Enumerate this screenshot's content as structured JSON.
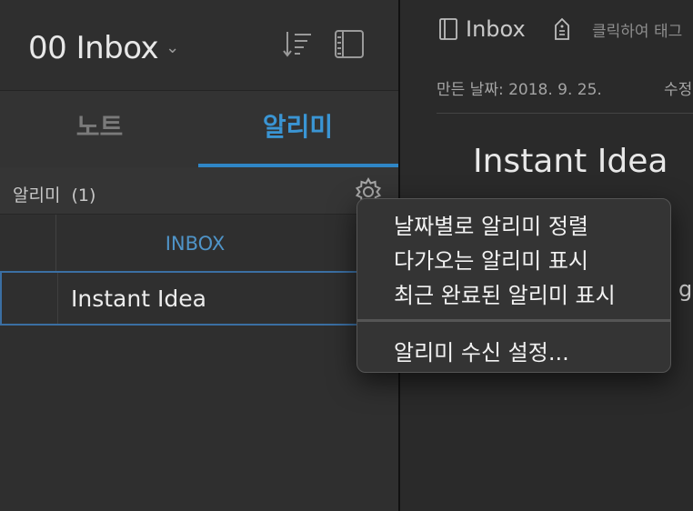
{
  "notebook": {
    "title": "00 Inbox"
  },
  "tabs": [
    {
      "label": "노트",
      "active": false
    },
    {
      "label": "알리미",
      "active": true
    }
  ],
  "section": {
    "label": "알리미",
    "count": "(1)"
  },
  "list": {
    "group_label": "INBOX",
    "items": [
      {
        "title": "Instant Idea"
      }
    ]
  },
  "note": {
    "notebook_name": "Inbox",
    "tag_placeholder": "클릭하여 태그",
    "created": "만든 날짜: 2018. 9. 25.",
    "modified_prefix": "수정",
    "title": "Instant Idea",
    "body_peek": "gli"
  },
  "context_menu": {
    "items": [
      "날짜별로 알리미 정렬",
      "다가오는 알리미 표시",
      "최근 완료된 알리미 표시",
      "알리미 수신 설정..."
    ]
  },
  "colors": {
    "accent": "#3a95d4",
    "selection": "#3b6fa3",
    "background": "#2f2f2f"
  }
}
